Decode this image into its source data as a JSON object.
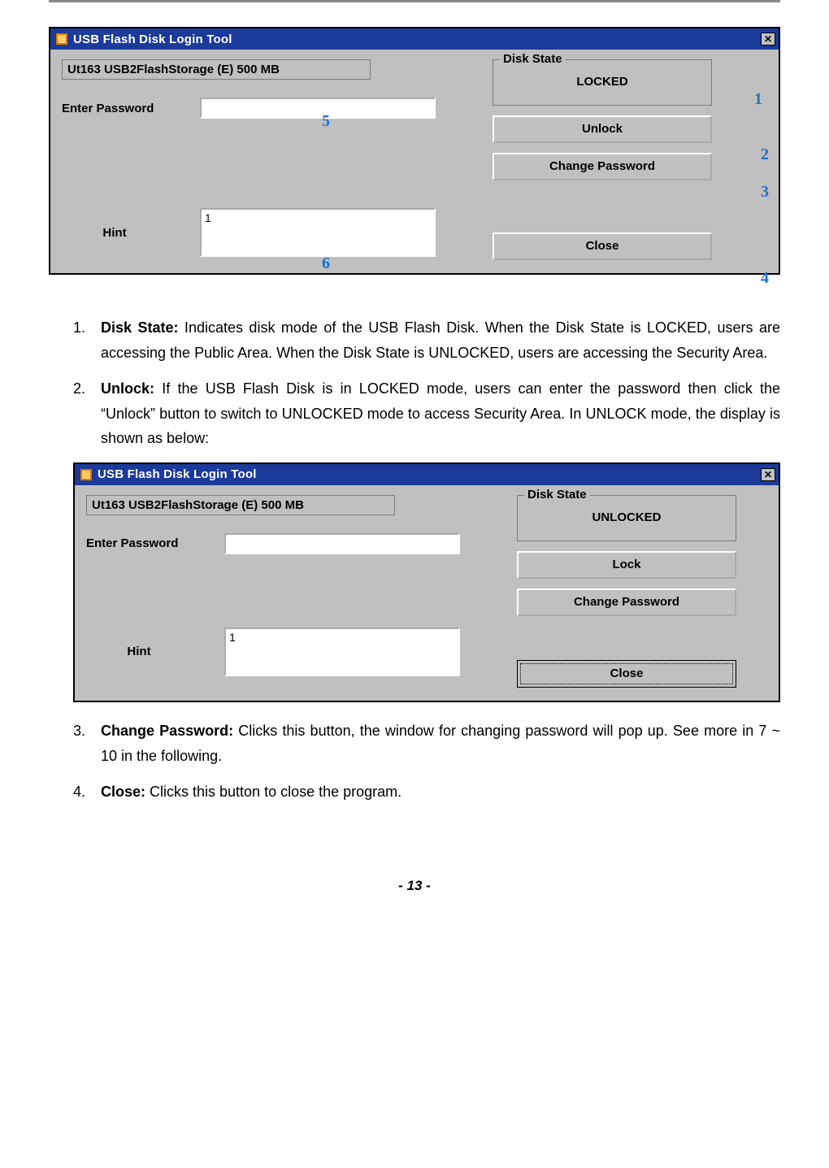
{
  "page_number_label": "- 13 -",
  "dialog1": {
    "title": "USB Flash Disk Login Tool",
    "device_info": "Ut163   USB2FlashStorage (E)  500 MB",
    "enter_password_label": "Enter Password",
    "password_value": "",
    "hint_label": "Hint",
    "hint_value": "1",
    "disk_state_legend": "Disk State",
    "disk_state_value": "LOCKED",
    "button_unlock": "Unlock",
    "button_change_password": "Change Password",
    "button_close": "Close",
    "annotations": {
      "one": "1",
      "two": "2",
      "three": "3",
      "four": "4",
      "five": "5",
      "six": "6"
    }
  },
  "dialog2": {
    "title": "USB Flash Disk Login Tool",
    "device_info": "Ut163   USB2FlashStorage (E)  500 MB",
    "enter_password_label": "Enter Password",
    "password_value": "",
    "hint_label": "Hint",
    "hint_value": "1",
    "disk_state_legend": "Disk State",
    "disk_state_value": "UNLOCKED",
    "button_lock": "Lock",
    "button_change_password": "Change Password",
    "button_close": "Close"
  },
  "list": {
    "item1_num": "1.",
    "item1_lead": "Disk State:",
    "item1_body": " Indicates disk mode of the USB Flash Disk. When the Disk State is LOCKED, users are accessing the Public Area. When the Disk State is UNLOCKED, users are accessing the Security Area.",
    "item2_num": "2.",
    "item2_lead": "Unlock:",
    "item2_body": " If the USB Flash Disk is in LOCKED mode, users can enter the password then click the “Unlock” button to switch to UNLOCKED mode to access Security Area. In UNLOCK mode, the display is shown as below:",
    "item3_num": "3.",
    "item3_lead": "Change Password:",
    "item3_body": " Clicks this button, the window for changing password will pop up. See more in 7 ~ 10 in the following.",
    "item4_num": "4.",
    "item4_lead": "Close:",
    "item4_body": " Clicks this button to close the program."
  }
}
